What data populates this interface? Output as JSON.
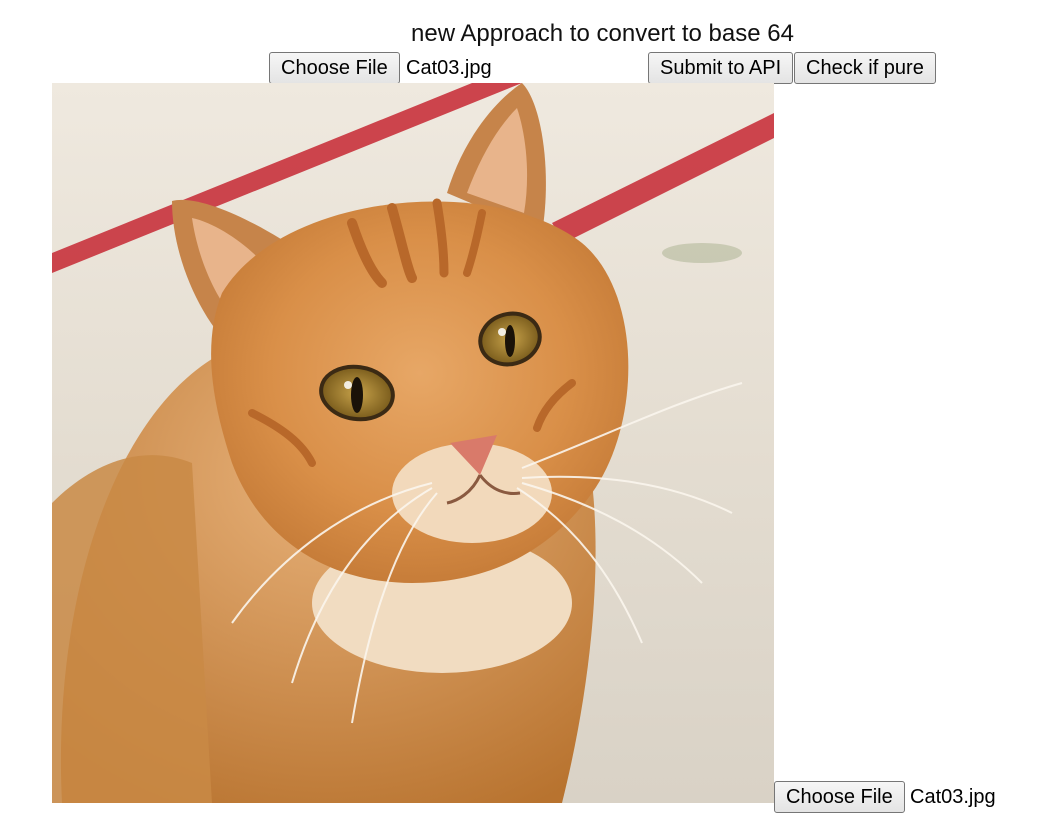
{
  "page": {
    "title": "new Approach to convert to base 64"
  },
  "top_toolbar": {
    "choose_file_label": "Choose File",
    "file_name": "Cat03.jpg",
    "submit_label": "Submit to API",
    "check_label": "Check if pure"
  },
  "bottom_toolbar": {
    "choose_file_label": "Choose File",
    "file_name": "Cat03.jpg"
  },
  "preview_image": {
    "subject": "photo of an orange tabby cat",
    "colors": {
      "fur": "#d9914a",
      "fur_dark": "#b86a2c",
      "fur_light": "#f3d6b0",
      "rail": "#c8323c",
      "background": "#e9e5dd",
      "eye": "#a8862c",
      "nose": "#d97a6a"
    }
  }
}
